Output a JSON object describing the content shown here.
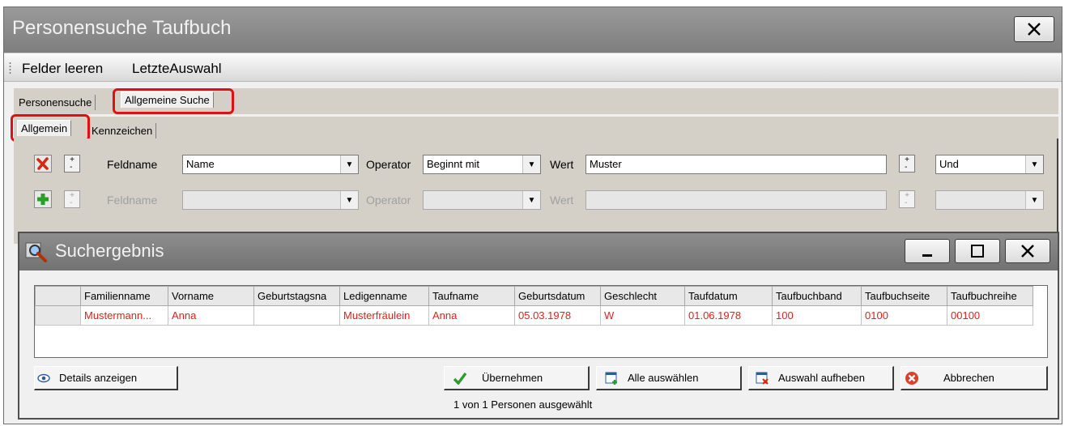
{
  "window": {
    "title": "Personensuche Taufbuch",
    "close_glyph": "✕"
  },
  "menu": {
    "items": [
      "Felder leeren",
      "LetzteAuswahl"
    ]
  },
  "tabs_outer": [
    "Personensuche",
    "Allgemeine Suche"
  ],
  "tabs_inner": [
    "Allgemein",
    "Kennzeichen"
  ],
  "criteria": {
    "row1": {
      "feldname_label": "Feldname",
      "feldname_value": "Name",
      "operator_label": "Operator",
      "operator_value": "Beginnt mit",
      "wert_label": "Wert",
      "wert_value": "Muster",
      "logic_value": "Und"
    },
    "row2": {
      "feldname_label": "Feldname",
      "operator_label": "Operator",
      "wert_label": "Wert"
    }
  },
  "results": {
    "title": "Suchergebnis",
    "columns": [
      "Familienname",
      "Vorname",
      "Geburtstagsna",
      "Ledigenname",
      "Taufname",
      "Geburtsdatum",
      "Geschlecht",
      "Taufdatum",
      "Taufbuchband",
      "Taufbuchseite",
      "Taufbuchreihe"
    ],
    "rows": [
      [
        "Mustermann...",
        "Anna",
        "",
        "Musterfräulein",
        "Anna",
        "05.03.1978",
        "W",
        "01.06.1978",
        "100",
        "0100",
        "00100"
      ]
    ],
    "status": "1 von 1 Personen ausgewählt"
  },
  "buttons": {
    "details": "Details anzeigen",
    "uebernehmen": "Übernehmen",
    "alle": "Alle auswählen",
    "aufheben": "Auswahl aufheben",
    "abbrechen": "Abbrechen"
  },
  "colors": {
    "highlight": "#e01010",
    "result_text": "#e02020",
    "titlebar": "#8a8a8a"
  },
  "icons": {
    "remove": "red-x-icon",
    "add": "green-plus-icon",
    "plus_minus": "plus-minus-icon",
    "check": "green-check-icon",
    "eye": "eye-icon",
    "select_all": "select-all-icon",
    "deselect": "deselect-icon",
    "cancel": "cancel-icon",
    "search_app": "search-app-icon"
  }
}
